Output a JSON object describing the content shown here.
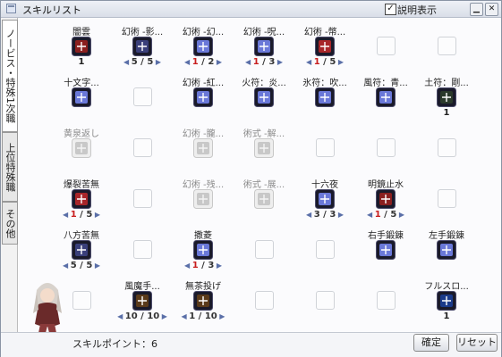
{
  "window": {
    "title": "スキルリスト",
    "show_description_label": "説明表示",
    "show_description_checked": true
  },
  "tabs": [
    {
      "label": "ノービス・特殊1次職",
      "active": true
    },
    {
      "label": "上位特殊職",
      "active": false
    },
    {
      "label": "その他",
      "active": false
    }
  ],
  "skills": [
    {
      "label": "闇雲",
      "learned": true,
      "dim": false,
      "color": "#8a1f1f",
      "level_text": "1"
    },
    {
      "label": "幻術 -影...",
      "learned": true,
      "dim": false,
      "color": "#3a3f7a",
      "cur": "5",
      "max": "5",
      "hi": false
    },
    {
      "label": "幻術 -幻...",
      "learned": true,
      "dim": false,
      "color": "#6a78d8",
      "cur": "1",
      "max": "2",
      "hi": true
    },
    {
      "label": "幻術 -呪...",
      "learned": true,
      "dim": false,
      "color": "#6a78d8",
      "cur": "1",
      "max": "3",
      "hi": true
    },
    {
      "label": "幻術 -幣...",
      "learned": true,
      "dim": false,
      "color": "#a8262a",
      "cur": "1",
      "max": "5",
      "hi": true
    },
    {
      "label": "",
      "learned": false
    },
    {
      "label": "",
      "learned": false
    },
    {
      "label": "十文字...",
      "learned": true,
      "dim": false,
      "color": "#6a78d8"
    },
    {
      "label": "",
      "learned": false
    },
    {
      "label": "幻術 -紅...",
      "learned": true,
      "dim": false,
      "color": "#6a78d8"
    },
    {
      "label": "火符：炎...",
      "learned": true,
      "dim": false,
      "color": "#6a78d8"
    },
    {
      "label": "氷符：吹...",
      "learned": true,
      "dim": false,
      "color": "#6a78d8"
    },
    {
      "label": "風符：青...",
      "learned": true,
      "dim": false,
      "color": "#6a78d8"
    },
    {
      "label": "土符：剛...",
      "learned": true,
      "dim": false,
      "color": "#2b3a2b",
      "level_text": "1"
    },
    {
      "label": "黄泉返し",
      "learned": false,
      "dim": true,
      "ghost": true
    },
    {
      "label": "",
      "learned": false
    },
    {
      "label": "幻術 -朧...",
      "learned": false,
      "dim": true,
      "ghost": true
    },
    {
      "label": "術式 -解...",
      "learned": false,
      "dim": true,
      "ghost": true
    },
    {
      "label": "",
      "learned": false
    },
    {
      "label": "",
      "learned": false
    },
    {
      "label": "",
      "learned": false
    },
    {
      "label": "爆裂苦無",
      "learned": true,
      "dim": false,
      "color": "#a8262a",
      "cur": "1",
      "max": "5",
      "hi": true
    },
    {
      "label": "",
      "learned": false
    },
    {
      "label": "幻術 -残...",
      "learned": false,
      "dim": true,
      "ghost": true
    },
    {
      "label": "術式 -展...",
      "learned": false,
      "dim": true,
      "ghost": true
    },
    {
      "label": "十六夜",
      "learned": true,
      "dim": false,
      "color": "#6a78d8",
      "cur": "3",
      "max": "3",
      "hi": false
    },
    {
      "label": "明鏡止水",
      "learned": true,
      "dim": false,
      "color": "#8a1f1f",
      "cur": "1",
      "max": "5",
      "hi": true
    },
    {
      "label": "",
      "learned": false
    },
    {
      "label": "八方苦無",
      "learned": true,
      "dim": false,
      "color": "#3a3f7a",
      "cur": "5",
      "max": "5",
      "hi": false
    },
    {
      "label": "",
      "learned": false
    },
    {
      "label": "撒菱",
      "learned": true,
      "dim": false,
      "color": "#6a78d8",
      "cur": "1",
      "max": "3",
      "hi": true
    },
    {
      "label": "",
      "learned": false
    },
    {
      "label": "",
      "learned": false
    },
    {
      "label": "右手鍛錬",
      "learned": true,
      "dim": false,
      "color": "#6a78d8"
    },
    {
      "label": "左手鍛錬",
      "learned": true,
      "dim": false,
      "color": "#6a78d8"
    },
    {
      "label": "",
      "learned": false
    },
    {
      "label": "風魔手...",
      "learned": true,
      "dim": false,
      "color": "#5a3a1a",
      "cur": "10",
      "max": "10",
      "hi": false
    },
    {
      "label": "無茶投げ",
      "learned": true,
      "dim": false,
      "color": "#5a3a1a",
      "cur": "1",
      "max": "10",
      "hi": false
    },
    {
      "label": "",
      "learned": false
    },
    {
      "label": "",
      "learned": false
    },
    {
      "label": "",
      "learned": false
    },
    {
      "label": "フルスロ...",
      "learned": true,
      "dim": false,
      "color": "#1a3a8a",
      "level_text": "1"
    }
  ],
  "footer": {
    "skill_points_label": "スキルポイント：6",
    "ok_label": "確定",
    "reset_label": "リセット"
  }
}
